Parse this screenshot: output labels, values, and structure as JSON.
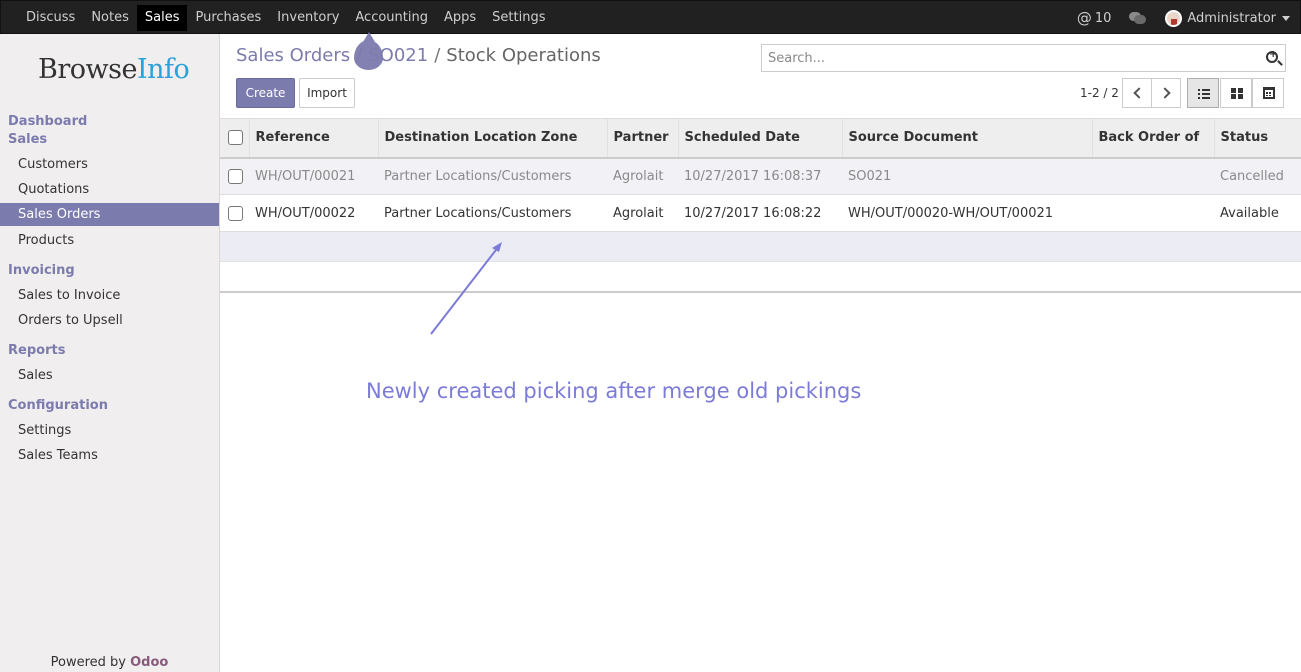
{
  "topnav": {
    "items": [
      {
        "label": "Discuss"
      },
      {
        "label": "Notes"
      },
      {
        "label": "Sales"
      },
      {
        "label": "Purchases"
      },
      {
        "label": "Inventory"
      },
      {
        "label": "Accounting"
      },
      {
        "label": "Apps"
      },
      {
        "label": "Settings"
      }
    ],
    "active": "Sales",
    "mentions_symbol": "@",
    "mentions_count": "10",
    "user_name": "Administrator"
  },
  "sidebar": {
    "logo_part1": "Browse",
    "logo_part2": "Info",
    "dashboard": "Dashboard",
    "sections": [
      {
        "title": "Sales",
        "items": [
          "Customers",
          "Quotations",
          "Sales Orders",
          "Products"
        ]
      },
      {
        "title": "Invoicing",
        "items": [
          "Sales to Invoice",
          "Orders to Upsell"
        ]
      },
      {
        "title": "Reports",
        "items": [
          "Sales"
        ]
      },
      {
        "title": "Configuration",
        "items": [
          "Settings",
          "Sales Teams"
        ]
      }
    ],
    "active_item": "Sales Orders",
    "powered_by": "Powered by",
    "powered_brand": "Odoo"
  },
  "breadcrumb": {
    "root": "Sales Orders",
    "middle": "SO021",
    "current": "Stock Operations",
    "separator": "/"
  },
  "search": {
    "placeholder": "Search..."
  },
  "buttons": {
    "create": "Create",
    "import": "Import"
  },
  "pager": {
    "text": "1-2 / 2"
  },
  "table": {
    "columns": [
      "Reference",
      "Destination Location Zone",
      "Partner",
      "Scheduled Date",
      "Source Document",
      "Back Order of",
      "Status"
    ],
    "rows": [
      {
        "reference": "WH/OUT/00021",
        "destination": "Partner Locations/Customers",
        "partner": "Agrolait",
        "scheduled": "10/27/2017 16:08:37",
        "source": "SO021",
        "backorder": "",
        "status": "Cancelled"
      },
      {
        "reference": "WH/OUT/00022",
        "destination": "Partner Locations/Customers",
        "partner": "Agrolait",
        "scheduled": "10/27/2017 16:08:22",
        "source": "WH/OUT/00020-WH/OUT/00021",
        "backorder": "",
        "status": "Available"
      }
    ]
  },
  "annotation": {
    "text": "Newly created picking after merge old pickings",
    "color": "#7c7bd8"
  },
  "colors": {
    "accent": "#7c7bad",
    "topbar": "#212121",
    "brand_blue": "#2aa1d9",
    "odoo": "#875a7b"
  }
}
